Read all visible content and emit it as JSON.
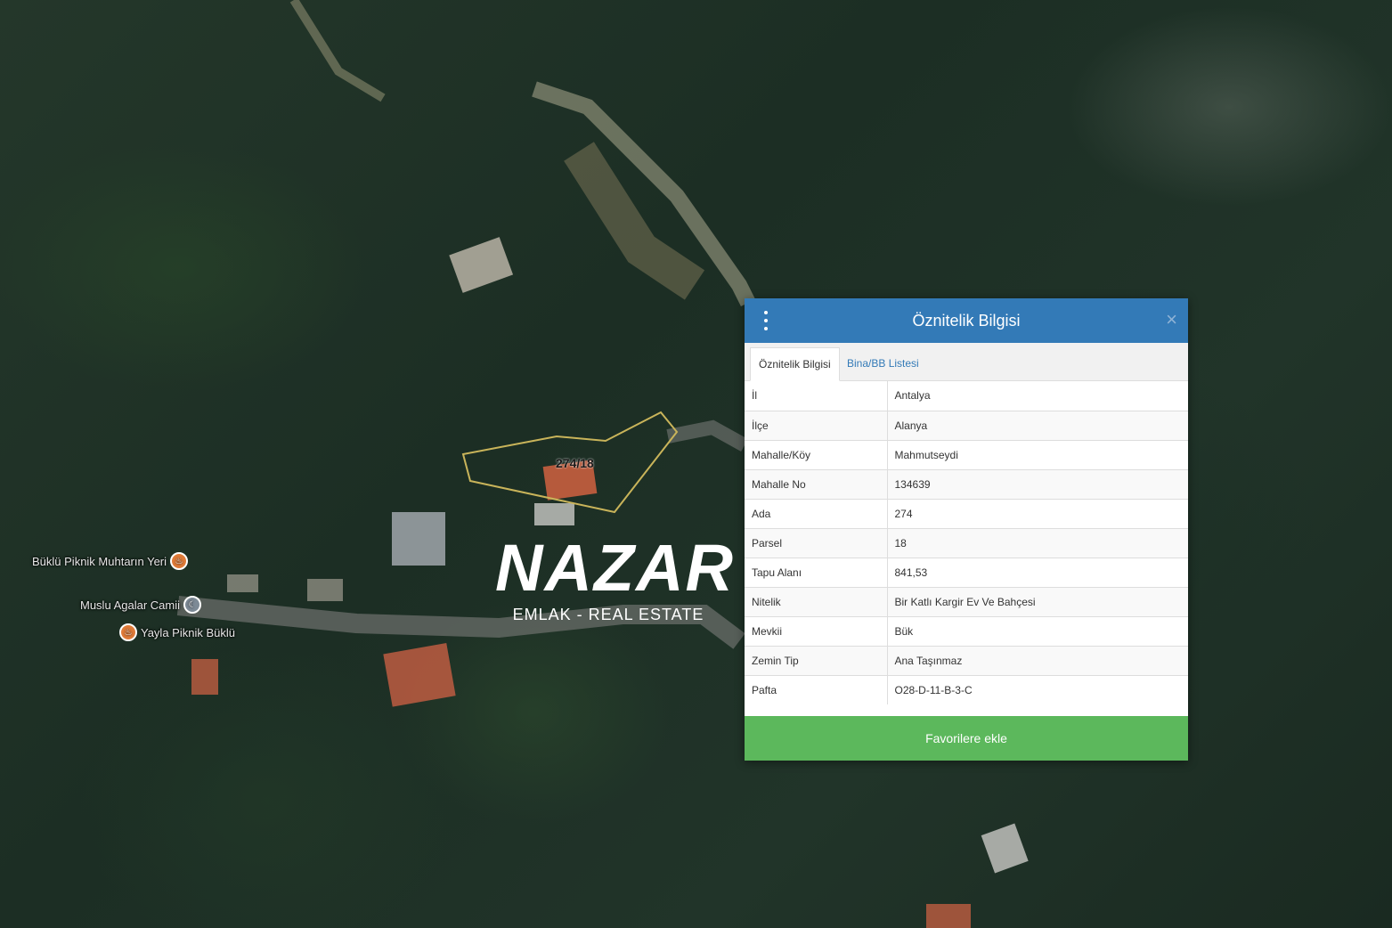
{
  "map": {
    "parcel_label": "274/18",
    "pois": [
      {
        "label": "Büklü Piknik Muhtarın Yeri",
        "icon": "restaurant-icon"
      },
      {
        "label": "Muslu Agalar Camii",
        "icon": "mosque-icon"
      },
      {
        "label": "Yayla Piknik Büklü",
        "icon": "restaurant-icon"
      }
    ]
  },
  "watermark": {
    "main": "NAZAR",
    "sub": "EMLAK - REAL ESTATE"
  },
  "panel": {
    "title": "Öznitelik Bilgisi",
    "menu_icon": "kebab-menu-icon",
    "close_icon": "close-icon",
    "close_glyph": "×",
    "tabs": [
      {
        "label": "Öznitelik Bilgisi",
        "active": true
      },
      {
        "label": "Bina/BB Listesi",
        "active": false
      }
    ],
    "rows": [
      {
        "key": "İl",
        "value": "Antalya"
      },
      {
        "key": "İlçe",
        "value": "Alanya"
      },
      {
        "key": "Mahalle/Köy",
        "value": "Mahmutseydi"
      },
      {
        "key": "Mahalle No",
        "value": "134639"
      },
      {
        "key": "Ada",
        "value": "274"
      },
      {
        "key": "Parsel",
        "value": "18"
      },
      {
        "key": "Tapu Alanı",
        "value": "841,53"
      },
      {
        "key": "Nitelik",
        "value": "Bir Katlı Kargir Ev Ve Bahçesi"
      },
      {
        "key": "Mevkii",
        "value": "Bük"
      },
      {
        "key": "Zemin Tip",
        "value": "Ana Taşınmaz"
      },
      {
        "key": "Pafta",
        "value": "O28-D-11-B-3-C"
      }
    ],
    "action_label": "Favorilere ekle"
  },
  "colors": {
    "header": "#337ab7",
    "action": "#5cb85c",
    "parcel_outline": "#c9b45a",
    "poi_pin": "#e07b39"
  }
}
